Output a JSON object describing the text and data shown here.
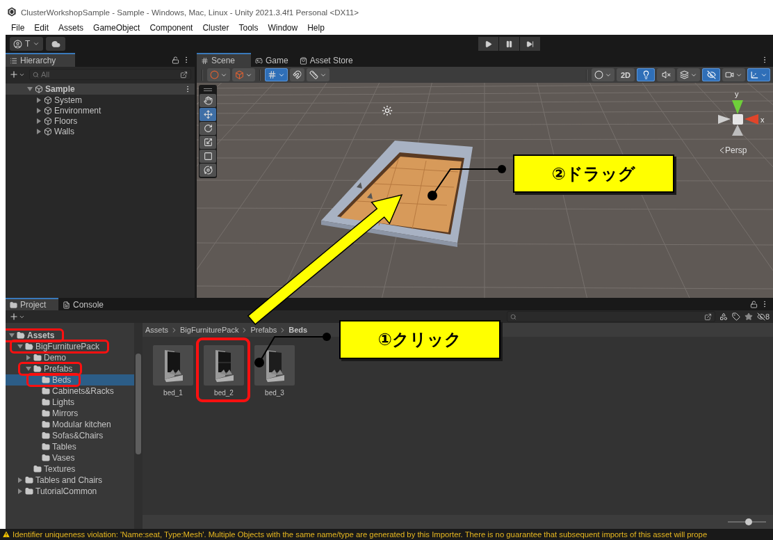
{
  "window": {
    "title": "ClusterWorkshopSample - Sample - Windows, Mac, Linux - Unity 2021.3.4f1 Personal <DX11>"
  },
  "menu": [
    "File",
    "Edit",
    "Assets",
    "GameObject",
    "Component",
    "Cluster",
    "Tools",
    "Window",
    "Help"
  ],
  "toolbar": {
    "account": "T",
    "play": false,
    "pause": false
  },
  "hierarchy": {
    "title": "Hierarchy",
    "search": {
      "placeholder": "All"
    },
    "tree": [
      {
        "label": "Sample",
        "expanded": true,
        "children": [
          {
            "label": "System",
            "expanded": false
          },
          {
            "label": "Environment",
            "expanded": false
          },
          {
            "label": "Floors",
            "expanded": false
          },
          {
            "label": "Walls",
            "expanded": false
          }
        ]
      }
    ]
  },
  "scene": {
    "tabs": [
      {
        "label": "Scene",
        "selected": true
      },
      {
        "label": "Game",
        "selected": false
      },
      {
        "label": "Asset Store",
        "selected": false
      }
    ],
    "left_toggles": [
      {
        "selected": false
      },
      {
        "selected": false
      },
      {
        "selected": true
      },
      {
        "selected": false
      },
      {
        "selected": false
      }
    ],
    "mode_2d": {
      "label": "2D",
      "selected": false
    },
    "right_toggles": [
      {
        "selected": false
      },
      {
        "selected": true
      },
      {
        "selected": false
      },
      {
        "selected": false
      },
      {
        "selected": true
      },
      {
        "selected": false
      },
      {
        "selected": true
      }
    ],
    "tools": [
      {
        "selected": false
      },
      {
        "selected": true
      },
      {
        "selected": false
      },
      {
        "selected": false
      },
      {
        "selected": false
      },
      {
        "selected": false
      }
    ],
    "gizmo_labels": [
      "y",
      "x"
    ],
    "view_label": "Persp"
  },
  "project": {
    "tabs": [
      {
        "label": "Project",
        "selected": true
      },
      {
        "label": "Console",
        "selected": false
      }
    ],
    "hidden_count": "8",
    "tree": [
      {
        "label": "Assets",
        "expanded": true,
        "selected": false,
        "highlighted": true,
        "children": [
          {
            "label": "BigFurniturePack",
            "expanded": true,
            "selected": false,
            "highlighted": true,
            "children": [
              {
                "label": "Demo",
                "expanded": false,
                "selected": false,
                "highlighted": false
              },
              {
                "label": "Prefabs",
                "expanded": true,
                "selected": false,
                "highlighted": true,
                "children": [
                  {
                    "label": "Beds",
                    "selected": true,
                    "highlighted": true
                  },
                  {
                    "label": "Cabinets&Racks",
                    "selected": false,
                    "highlighted": false
                  },
                  {
                    "label": "Lights",
                    "selected": false,
                    "highlighted": false
                  },
                  {
                    "label": "Mirrors",
                    "selected": false,
                    "highlighted": false
                  },
                  {
                    "label": "Modular kitchen",
                    "selected": false,
                    "highlighted": false
                  },
                  {
                    "label": "Sofas&Chairs",
                    "selected": false,
                    "highlighted": false
                  },
                  {
                    "label": "Tables",
                    "selected": false,
                    "highlighted": false
                  },
                  {
                    "label": "Vases",
                    "selected": false,
                    "highlighted": false
                  }
                ]
              },
              {
                "label": "Textures",
                "selected": false,
                "highlighted": false
              }
            ]
          },
          {
            "label": "Tables and Chairs",
            "expanded": false,
            "selected": false,
            "highlighted": false
          },
          {
            "label": "TutorialCommon",
            "expanded": false,
            "selected": false,
            "highlighted": false
          }
        ]
      }
    ],
    "breadcrumb": [
      "Assets",
      "BigFurniturePack",
      "Prefabs",
      "Beds"
    ],
    "assets": [
      {
        "label": "bed_1",
        "highlighted": false
      },
      {
        "label": "bed_2",
        "highlighted": true
      },
      {
        "label": "bed_3",
        "highlighted": false
      }
    ],
    "zoom_slider": {
      "level": 0.55
    }
  },
  "annotations": [
    {
      "kind": "callout",
      "text": "②ドラッグ"
    },
    {
      "kind": "callout",
      "text": "①クリック"
    }
  ],
  "status": {
    "kind": "warning",
    "text": "Identifier uniqueness violation: 'Name:seat, Type:Mesh'. Multiple Objects with the same name/type are generated by this Importer. There is no guarantee that subsequent imports of this asset will prope"
  }
}
